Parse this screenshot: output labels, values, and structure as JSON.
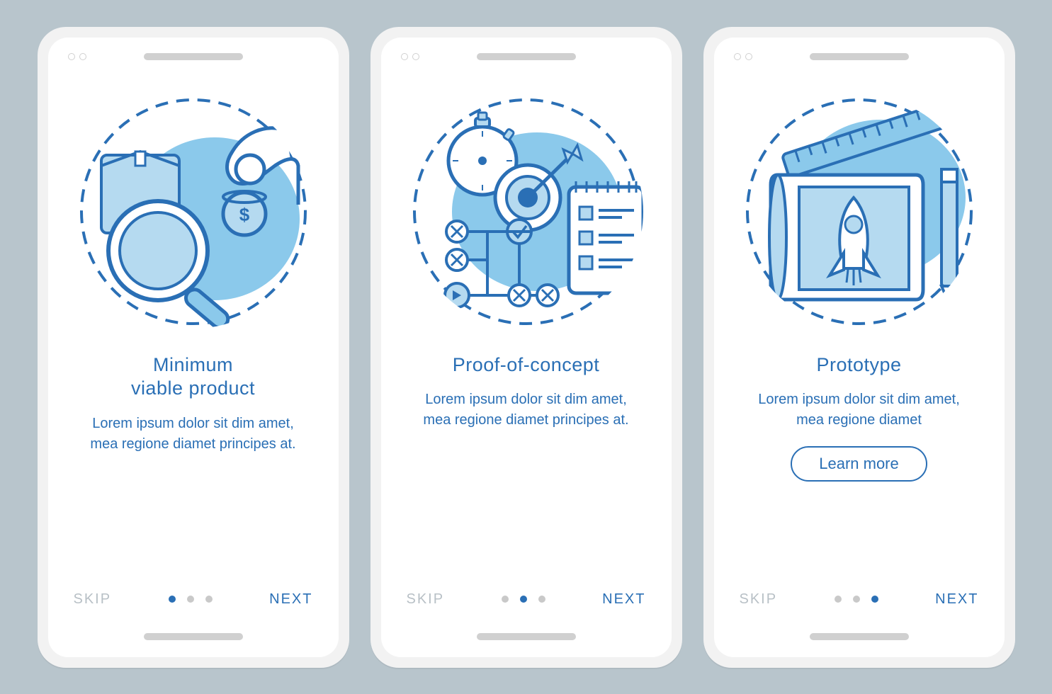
{
  "colors": {
    "accent": "#2a6fb5",
    "light": "#b5daf0",
    "fill": "#8bc9eb"
  },
  "screens": [
    {
      "title": "Minimum\nviable product",
      "body": "Lorem ipsum dolor sit dim amet, mea regione diamet principes at.",
      "skip": "SKIP",
      "next": "NEXT",
      "active_dot": 0,
      "has_cta": false,
      "cta": ""
    },
    {
      "title": "Proof-of-concept",
      "body": "Lorem ipsum dolor sit dim amet, mea regione diamet principes at.",
      "skip": "SKIP",
      "next": "NEXT",
      "active_dot": 1,
      "has_cta": false,
      "cta": ""
    },
    {
      "title": "Prototype",
      "body": "Lorem ipsum dolor sit dim amet, mea regione diamet",
      "skip": "SKIP",
      "next": "NEXT",
      "active_dot": 2,
      "has_cta": true,
      "cta": "Learn more"
    }
  ]
}
